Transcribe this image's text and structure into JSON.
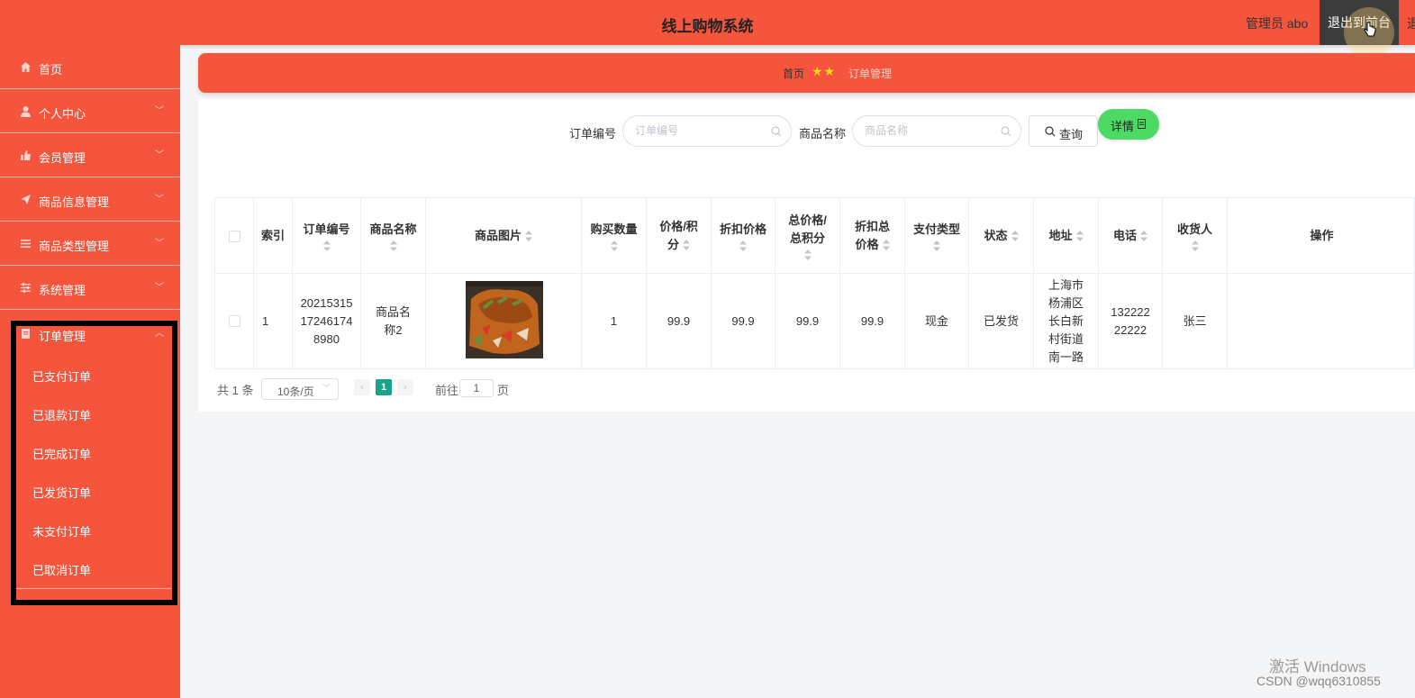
{
  "header": {
    "title": "线上购物系统",
    "admin_label": "管理员 abo",
    "exit_button": "退出到前台",
    "edge_text": "退"
  },
  "sidebar": {
    "items": [
      {
        "label": "首页",
        "icon": "home-icon",
        "has_arrow": false
      },
      {
        "label": "个人中心",
        "icon": "user-icon",
        "has_arrow": true
      },
      {
        "label": "会员管理",
        "icon": "thumb-icon",
        "has_arrow": true
      },
      {
        "label": "商品信息管理",
        "icon": "send-icon",
        "has_arrow": true
      },
      {
        "label": "商品类型管理",
        "icon": "list-icon",
        "has_arrow": true
      },
      {
        "label": "系统管理",
        "icon": "settings-icon",
        "has_arrow": true
      },
      {
        "label": "订单管理",
        "icon": "document-icon",
        "has_arrow": true,
        "expanded": true
      }
    ],
    "sub_items": [
      "已支付订单",
      "已退款订单",
      "已完成订单",
      "已发货订单",
      "未支付订单",
      "已取消订单"
    ]
  },
  "breadcrumb": {
    "home": "首页",
    "separator": "★★",
    "current": "订单管理"
  },
  "search": {
    "order_no_label": "订单编号",
    "order_no_placeholder": "订单编号",
    "product_name_label": "商品名称",
    "product_name_placeholder": "商品名称",
    "query_button": "查询"
  },
  "table": {
    "headers": [
      "索引",
      "订单编号",
      "商品名称",
      "商品图片",
      "购买数量",
      "价格/积分",
      "折扣价格",
      "总价格/总积分",
      "折扣总价格",
      "支付类型",
      "状态",
      "地址",
      "电话",
      "收货人",
      "操作"
    ],
    "rows": [
      {
        "index": "1",
        "order_no": "2021531517246174 8980",
        "product_name": "商品名称2",
        "quantity": "1",
        "price": "99.9",
        "discount_price": "99.9",
        "total_price": "99.9",
        "discount_total": "99.9",
        "pay_type": "现金",
        "status": "已发货",
        "address": "上海市杨浦区长白新村街道南一路",
        "phone": "13222222222",
        "receiver": "张三",
        "action": "详情"
      }
    ]
  },
  "pagination": {
    "total": "共 1 条",
    "page_size": "10条/页",
    "current_page": "1",
    "goto_prefix": "前往",
    "goto_value": "1",
    "goto_suffix": "页"
  },
  "watermark": {
    "windows": "激活 Windows",
    "csdn": "CSDN @wqq6310855"
  },
  "colors": {
    "primary": "#f5553c",
    "success": "#4cd964",
    "page_active": "#17a589"
  }
}
